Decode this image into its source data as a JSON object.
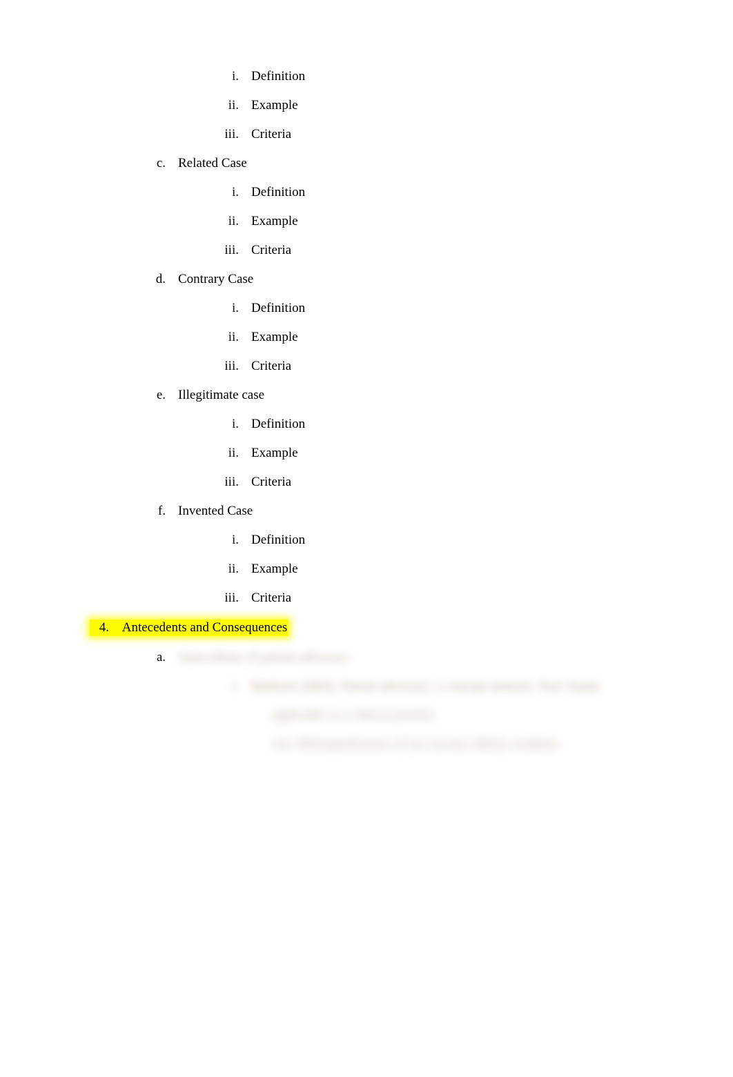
{
  "roman_sublist": {
    "i": "Definition",
    "ii": "Example",
    "iii": "Criteria"
  },
  "sections": [
    {
      "marker": "c.",
      "label": "Related Case"
    },
    {
      "marker": "d.",
      "label": "Contrary Case"
    },
    {
      "marker": "e.",
      "label": "Illegitimate case"
    },
    {
      "marker": "f.",
      "label": "Invented Case"
    }
  ],
  "numbered": {
    "marker": "4.",
    "label": "Antecedents and Consequences"
  },
  "sub_a": {
    "marker": "a.",
    "blurred_heading": "Antecedents of patient advocacy",
    "blurred_sub_marker": "i.",
    "blurred_lines": [
      "Baldwin (2003). Patient advocacy: a concept analysis. Nurs Stand.",
      "applicable to a clinical practice",
      "cite: Rehospitalization of low income elderly residents"
    ]
  },
  "markers": {
    "i": "i.",
    "ii": "ii.",
    "iii": "iii."
  }
}
